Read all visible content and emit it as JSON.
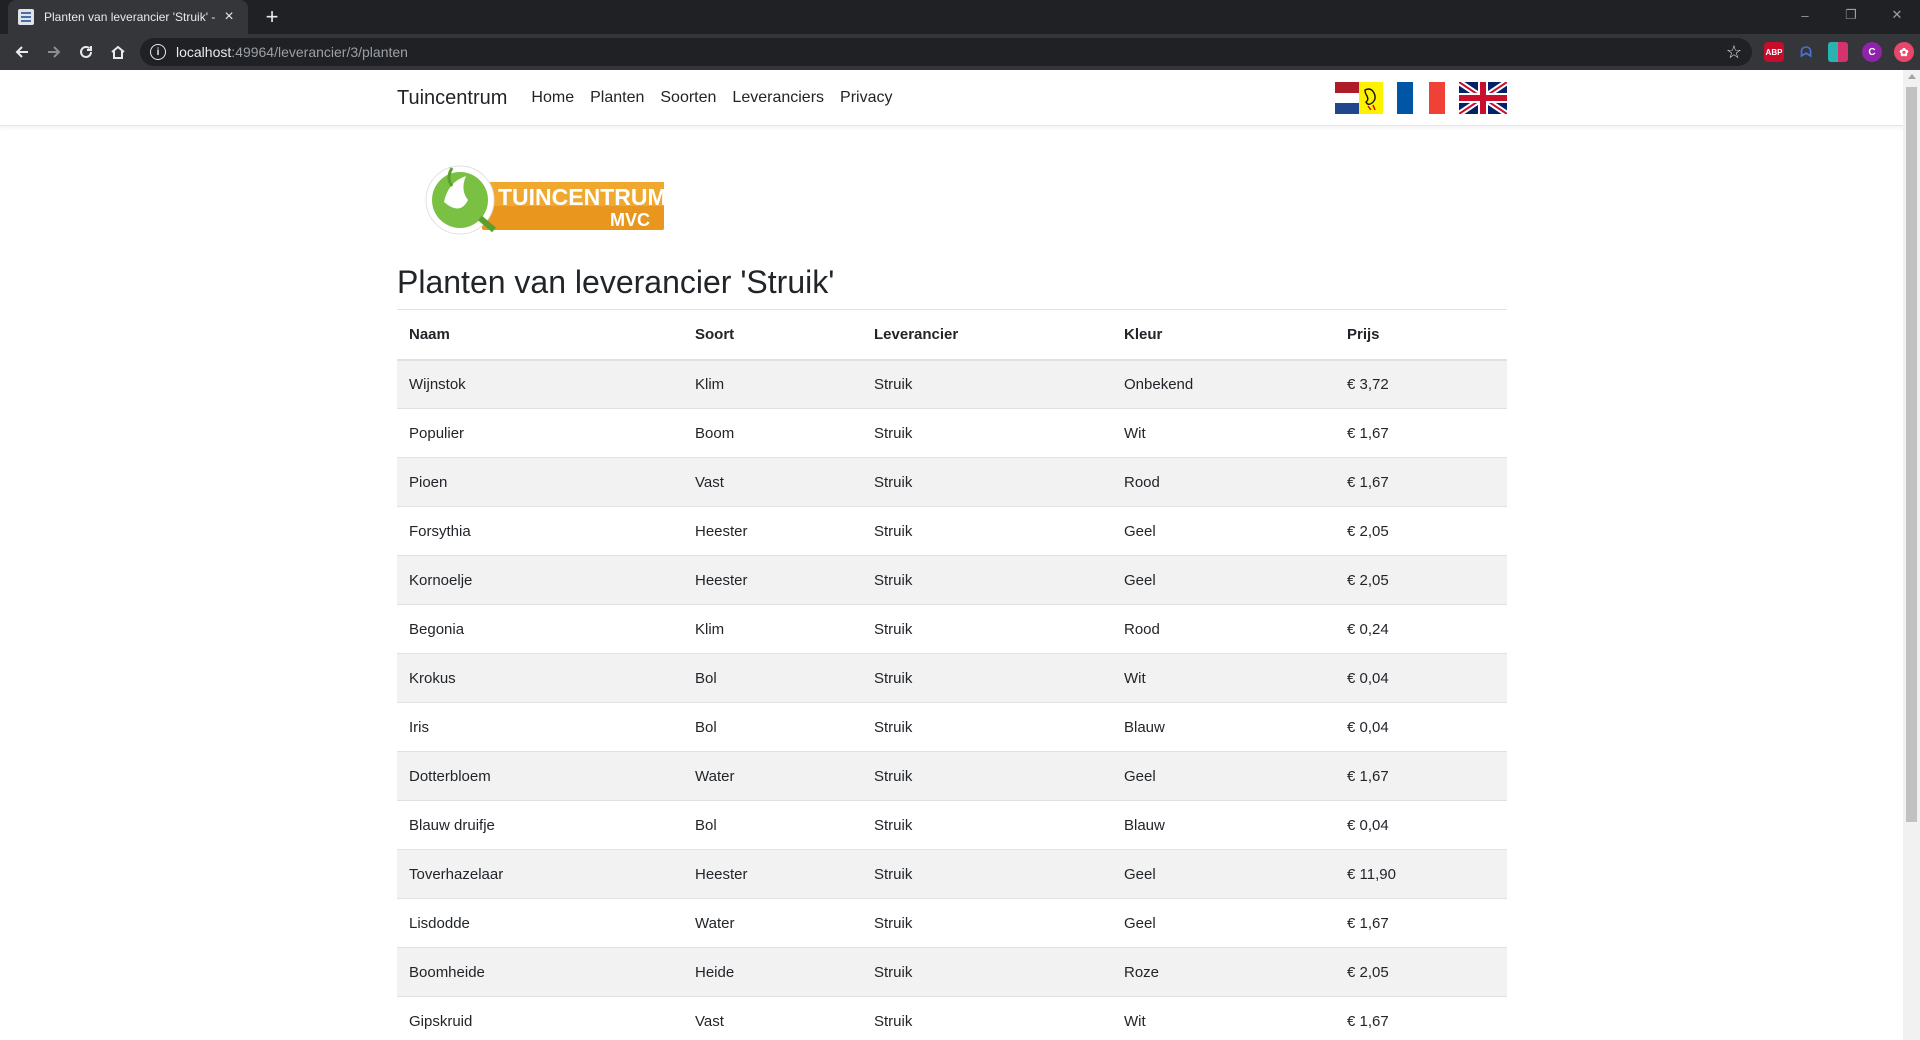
{
  "browser": {
    "tab_title": "Planten van leverancier 'Struik' -",
    "url_host": "localhost",
    "url_path": ":49964/leverancier/3/planten",
    "extensions": [
      "ABP",
      "ghost-icon",
      "book-icon",
      "C",
      "pink-icon"
    ],
    "window_controls": [
      "–",
      "❐",
      "✕"
    ]
  },
  "nav": {
    "brand": "Tuincentrum",
    "links": [
      "Home",
      "Planten",
      "Soorten",
      "Leveranciers",
      "Privacy"
    ],
    "flags": [
      "flag-nl",
      "flag-fr",
      "flag-uk"
    ]
  },
  "logo": {
    "line1": "TUINCENTRUM",
    "line2": "MVC"
  },
  "page": {
    "title": "Planten van leverancier 'Struik'"
  },
  "table": {
    "columns": [
      "Naam",
      "Soort",
      "Leverancier",
      "Kleur",
      "Prijs"
    ],
    "rows": [
      [
        "Wijnstok",
        "Klim",
        "Struik",
        "Onbekend",
        "€ 3,72"
      ],
      [
        "Populier",
        "Boom",
        "Struik",
        "Wit",
        "€ 1,67"
      ],
      [
        "Pioen",
        "Vast",
        "Struik",
        "Rood",
        "€ 1,67"
      ],
      [
        "Forsythia",
        "Heester",
        "Struik",
        "Geel",
        "€ 2,05"
      ],
      [
        "Kornoelje",
        "Heester",
        "Struik",
        "Geel",
        "€ 2,05"
      ],
      [
        "Begonia",
        "Klim",
        "Struik",
        "Rood",
        "€ 0,24"
      ],
      [
        "Krokus",
        "Bol",
        "Struik",
        "Wit",
        "€ 0,04"
      ],
      [
        "Iris",
        "Bol",
        "Struik",
        "Blauw",
        "€ 0,04"
      ],
      [
        "Dotterbloem",
        "Water",
        "Struik",
        "Geel",
        "€ 1,67"
      ],
      [
        "Blauw druifje",
        "Bol",
        "Struik",
        "Blauw",
        "€ 0,04"
      ],
      [
        "Toverhazelaar",
        "Heester",
        "Struik",
        "Geel",
        "€ 11,90"
      ],
      [
        "Lisdodde",
        "Water",
        "Struik",
        "Geel",
        "€ 1,67"
      ],
      [
        "Boomheide",
        "Heide",
        "Struik",
        "Roze",
        "€ 2,05"
      ],
      [
        "Gipskruid",
        "Vast",
        "Struik",
        "Wit",
        "€ 1,67"
      ]
    ]
  }
}
